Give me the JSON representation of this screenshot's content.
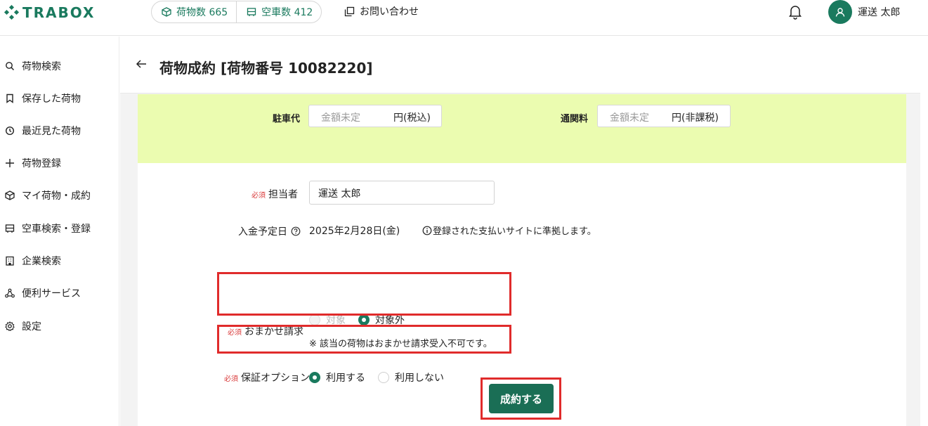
{
  "header": {
    "logo": "TRABOX",
    "cargo_count_label": "荷物数 665",
    "vehicle_count_label": "空車数 412",
    "contact_label": "お問い合わせ",
    "user_name": "運送  太郎"
  },
  "sidebar": {
    "items": [
      {
        "label": "荷物検索",
        "icon": "search-icon"
      },
      {
        "label": "保存した荷物",
        "icon": "bookmark-icon"
      },
      {
        "label": "最近見た荷物",
        "icon": "history-icon"
      },
      {
        "label": "荷物登録",
        "icon": "plus-icon"
      },
      {
        "label": "マイ荷物・成約",
        "icon": "box-icon"
      },
      {
        "label": "空車検索・登録",
        "icon": "truck-icon"
      },
      {
        "label": "企業検索",
        "icon": "building-icon"
      },
      {
        "label": "便利サービス",
        "icon": "network-icon"
      },
      {
        "label": "設定",
        "icon": "gear-icon"
      }
    ]
  },
  "page": {
    "title": "荷物成約 [荷物番号 10082220]"
  },
  "fees": {
    "parking_label": "駐車代",
    "parking_placeholder": "金額未定",
    "parking_unit": "円(税込)",
    "customs_label": "通関料",
    "customs_placeholder": "金額未定",
    "customs_unit": "円(非課税)"
  },
  "form": {
    "required_mark": "必須",
    "person_label": "担当者",
    "person_value": "運送  太郎",
    "payment_date_label": "入金予定日",
    "payment_date_value": "2025年2月28日(金)",
    "payment_note": "登録された支払いサイトに準拠します。",
    "auto_billing_label": "おまかせ請求",
    "auto_billing_options": [
      "対象",
      "対象外"
    ],
    "auto_billing_selected": "対象外",
    "auto_billing_note": "※ 該当の荷物はおまかせ請求受入不可です。",
    "guarantee_label": "保証オプション",
    "guarantee_options": [
      "利用する",
      "利用しない"
    ],
    "guarantee_selected": "利用する",
    "submit_label": "成約する"
  },
  "colors": {
    "brand": "#1a7a5e",
    "fee_panel": "#ebfcb0",
    "required": "#d93a3a",
    "highlight": "#e02b2b"
  }
}
